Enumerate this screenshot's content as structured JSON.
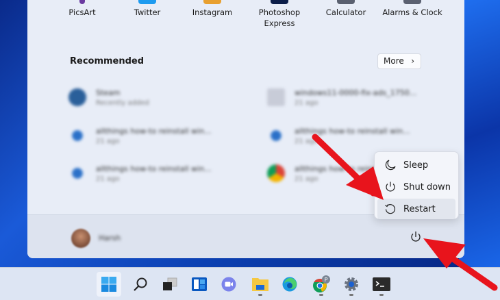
{
  "pinned": [
    {
      "label": "PicsArt",
      "color": "#6a3aa0"
    },
    {
      "label": "Twitter",
      "color": "#1d9bf0"
    },
    {
      "label": "Instagram",
      "color": "#e8a030"
    },
    {
      "label": "Photoshop Express",
      "color": "#0c1e4a"
    },
    {
      "label": "Calculator",
      "color": "#5a6070"
    },
    {
      "label": "Alarms & Clock",
      "color": "#5a6070"
    }
  ],
  "recommended": {
    "title": "Recommended",
    "more_label": "More",
    "items": [
      {
        "name": "Steam",
        "sub": "Recently added",
        "color": "#2a5f9a"
      },
      {
        "name": "windows11-0000-fix-ads_1750...",
        "sub": "21 ago",
        "color": "#c8ccd8"
      },
      {
        "name": "allthings how-to reinstall win...",
        "sub": "21 ago",
        "color": "#2a70c8"
      },
      {
        "name": "allthings how-to reinstall win...",
        "sub": "21 ago",
        "color": "#2a70c8"
      },
      {
        "name": "allthings how-to reinstall win...",
        "sub": "21 ago",
        "color": "#2a70c8"
      },
      {
        "name": "allthings how-to reinstall win...",
        "sub": "21 ago",
        "color": "#db4437"
      }
    ]
  },
  "user": {
    "name": "Harsh"
  },
  "power_menu": [
    {
      "label": "Sleep",
      "icon": "moon-icon"
    },
    {
      "label": "Shut down",
      "icon": "power-icon"
    },
    {
      "label": "Restart",
      "icon": "restart-icon"
    }
  ],
  "taskbar": [
    "start",
    "search",
    "task-view",
    "widgets",
    "teams-chat",
    "file-explorer",
    "edge",
    "chrome",
    "settings",
    "terminal"
  ],
  "chrome_badge": "P",
  "colors": {
    "arrow": "#e8141c",
    "accent": "#0067c0"
  }
}
